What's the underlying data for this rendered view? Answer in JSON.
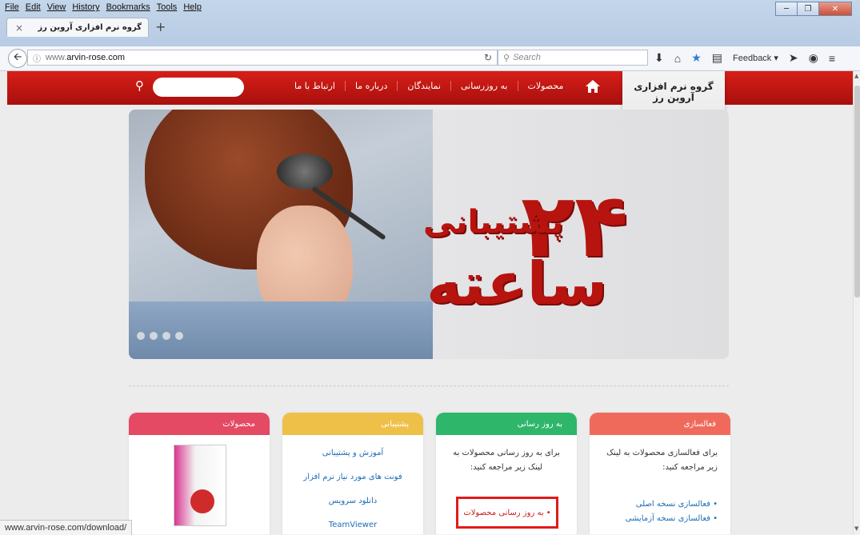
{
  "browser": {
    "menu": [
      "File",
      "Edit",
      "View",
      "History",
      "Bookmarks",
      "Tools",
      "Help"
    ],
    "tab_title": "گروه نرم افزاری آروین رز",
    "tab_close": "×",
    "new_tab": "+",
    "url_prefix": "www.",
    "url_domain": "arvin-rose.com",
    "search_placeholder": "Search",
    "feedback_label": "Feedback",
    "status_url": "www.arvin-rose.com/download/"
  },
  "site": {
    "logo_title": "گروه نرم افزاری آروین رز",
    "nav": [
      "محصولات",
      "به روزرسانی",
      "نمایندگان",
      "درباره ما",
      "ارتباط با ما"
    ],
    "banner": {
      "number": "۲۴",
      "line1": "پشتیبانی",
      "line2": "ساعته"
    },
    "cards": [
      {
        "title": "فعالسازی",
        "color": "#f06a5b",
        "text": "برای فعالسازی محصولات به لینک زیر مراجعه کنید:",
        "links": [
          "• فعالسازی نسخه اصلی",
          "• فعالسازی نسخه آزمایشی"
        ]
      },
      {
        "title": "به روز رسانی",
        "color": "#2eb66b",
        "text": "برای به روز رسانی محصولات به لینک زیر مراجعه کنید:",
        "highlight": "• به روز رسانی محصولات"
      },
      {
        "title": "پشتیبانی",
        "color": "#eec048",
        "links": [
          "آموزش و پشتیبانی",
          "فونت های مورد نیاز نرم افزار",
          "دانلود سرویس",
          "TeamViewer"
        ]
      },
      {
        "title": "محصولات",
        "color": "#e44a63"
      }
    ]
  }
}
